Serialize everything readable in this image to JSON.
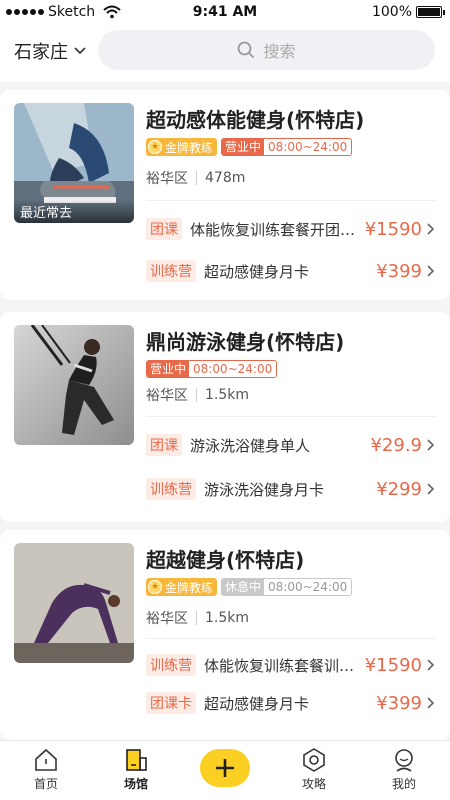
{
  "status_bar": {
    "carrier": "Sketch",
    "time": "9:41 AM",
    "battery": "100%"
  },
  "header": {
    "city": "石家庄",
    "search_placeholder": "搜索"
  },
  "stores": [
    {
      "name": "超动感体能健身(怀特店)",
      "image_tag": "最近常去",
      "badge_gold": "金牌教练",
      "status": "营业中",
      "status_type": "open",
      "hours": "08:00~24:00",
      "district": "裕华区",
      "distance": "478m",
      "offers": [
        {
          "tag": "团课",
          "title": "体能恢复训练套餐开团…",
          "price": "¥1590"
        },
        {
          "tag": "训练营",
          "title": "超动感健身月卡",
          "price": "¥399"
        }
      ]
    },
    {
      "name": "鼎尚游泳健身(怀特店)",
      "status": "营业中",
      "status_type": "open",
      "hours": "08:00~24:00",
      "district": "裕华区",
      "distance": "1.5km",
      "offers": [
        {
          "tag": "团课",
          "title": "游泳洗浴健身单人",
          "price": "¥29.9"
        },
        {
          "tag": "训练营",
          "title": "游泳洗浴健身月卡",
          "price": "¥299"
        }
      ]
    },
    {
      "name": "超越健身(怀特店)",
      "badge_gold": "金牌教练",
      "status": "休息中",
      "status_type": "rest",
      "hours": "08:00~24:00",
      "district": "裕华区",
      "distance": "1.5km",
      "offers": [
        {
          "tag": "训练营",
          "title": "体能恢复训练套餐训…",
          "price": "¥1590"
        },
        {
          "tag": "团课卡",
          "title": "超动感健身月卡",
          "price": "¥399"
        }
      ]
    }
  ],
  "tabbar": {
    "home": "首页",
    "venue": "场馆",
    "guide": "攻略",
    "mine": "我的",
    "active": "venue"
  },
  "colors": {
    "accent": "#e8694a",
    "gold": "#f6b73c",
    "plus": "#fbd022"
  }
}
